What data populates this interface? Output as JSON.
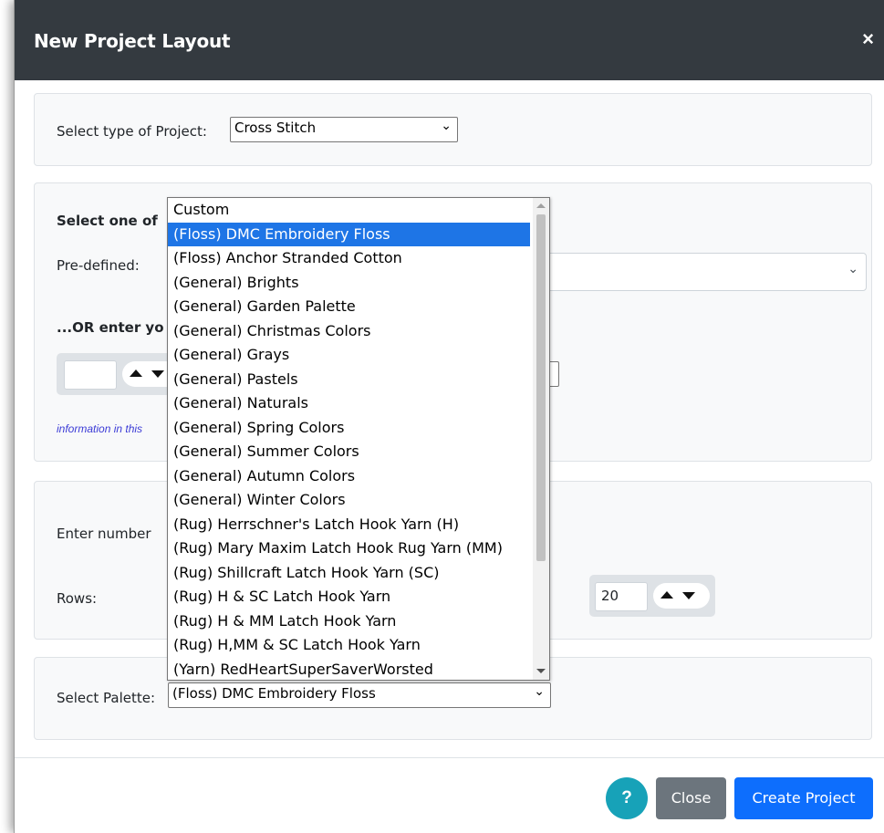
{
  "modal": {
    "title": "New Project Layout",
    "close_icon": "×"
  },
  "project_type": {
    "label": "Select type of Project:",
    "selected": "Cross Stitch"
  },
  "palette_section": {
    "heading": "Select one of",
    "predefined_label": "Pre-defined:",
    "or_heading": "...OR enter yo",
    "info_text": "information in this"
  },
  "size_section": {
    "enter_label": "Enter number",
    "rows_label": "Rows:",
    "rows_value": "20"
  },
  "select_palette": {
    "label": "Select Palette:",
    "selected": "(Floss) DMC Embroidery Floss"
  },
  "dropdown": {
    "options": [
      "Custom",
      "(Floss) DMC Embroidery Floss",
      "(Floss) Anchor Stranded Cotton",
      "(General) Brights",
      "(General) Garden Palette",
      "(General) Christmas Colors",
      "(General) Grays",
      "(General) Pastels",
      "(General) Naturals",
      "(General) Spring Colors",
      "(General) Summer Colors",
      "(General) Autumn Colors",
      "(General) Winter Colors",
      "(Rug) Herrschner's Latch Hook Yarn (H)",
      "(Rug) Mary Maxim Latch Hook Rug Yarn (MM)",
      "(Rug) Shillcraft Latch Hook Yarn (SC)",
      "(Rug) H & SC Latch Hook Yarn",
      "(Rug) H & MM Latch Hook Yarn",
      "(Rug) H,MM & SC Latch Hook Yarn",
      "(Yarn) RedHeartSuperSaverWorsted"
    ],
    "selected_index": 1
  },
  "footer": {
    "help_label": "?",
    "close_label": "Close",
    "create_label": "Create Project"
  },
  "icons": {
    "chevron": "chevron-down-icon",
    "stepper": "up-down-arrows-icon",
    "close": "close-icon"
  },
  "colors": {
    "header_bg": "#343a40",
    "primary": "#0d6efd",
    "secondary": "#6c757d",
    "info": "#17a2b8",
    "selected_option": "#1e75e6"
  }
}
